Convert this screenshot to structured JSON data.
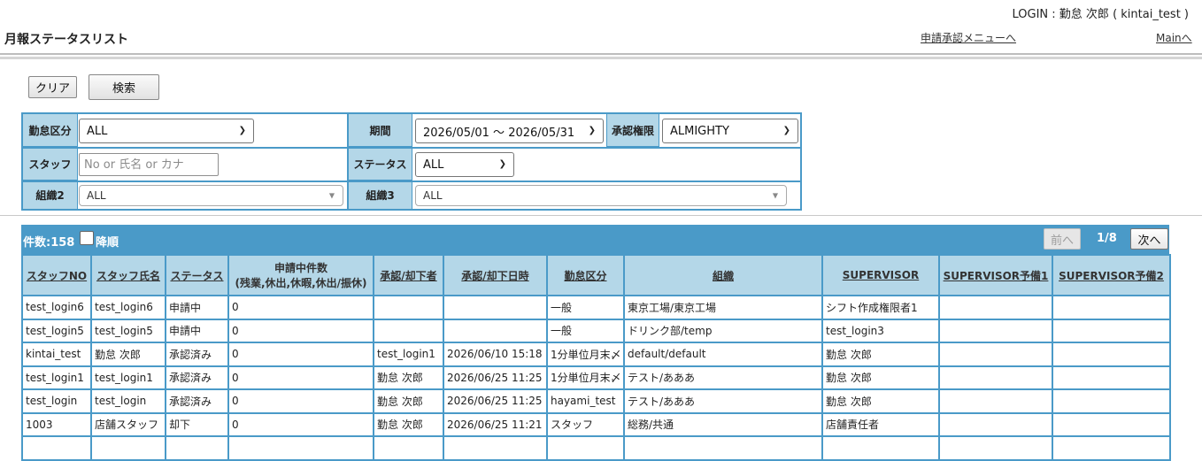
{
  "header": {
    "login": "LOGIN : 勤怠 次郎 ( kintai_test )",
    "title": "月報ステータスリスト",
    "approval_menu_link": "申請承認メニューへ",
    "main_link": "Mainへ"
  },
  "buttons": {
    "clear": "クリア",
    "search": "検索"
  },
  "filters": {
    "kintai_kubun": {
      "label": "勤怠区分",
      "value": "ALL"
    },
    "period": {
      "label": "期間",
      "value": "2026/05/01 ～ 2026/05/31"
    },
    "approval_authority": {
      "label": "承認権限",
      "value": "ALMIGHTY"
    },
    "staff": {
      "label": "スタッフ",
      "placeholder": "No or 氏名 or カナ"
    },
    "status": {
      "label": "ステータス",
      "value": "ALL"
    },
    "org2": {
      "label": "組織2",
      "value": "ALL"
    },
    "org3": {
      "label": "組織3",
      "value": "ALL"
    }
  },
  "list_bar": {
    "count": "件数:158",
    "desc_label": "降順",
    "prev": "前へ",
    "page": "1/8",
    "next": "次へ"
  },
  "table": {
    "headers": [
      "スタッフNO",
      "スタッフ氏名",
      "ステータス",
      "申請中件数\n(残業,休出,休暇,休出/振休)",
      "承認/却下者",
      "承認/却下日時",
      "勤怠区分",
      "組織",
      "SUPERVISOR",
      "SUPERVISOR予備1",
      "SUPERVISOR予備2"
    ],
    "rows": [
      [
        "test_login6",
        "test_login6",
        "申請中",
        "0",
        "",
        "",
        "一般",
        "東京工場/東京工場",
        "シフト作成権限者1",
        "",
        ""
      ],
      [
        "test_login5",
        "test_login5",
        "申請中",
        "0",
        "",
        "",
        "一般",
        "ドリンク部/temp",
        "test_login3",
        "",
        ""
      ],
      [
        "kintai_test",
        "勤怠 次郎",
        "承認済み",
        "0",
        "test_login1",
        "2026/06/10 15:18",
        "1分単位月末〆",
        "default/default",
        "勤怠 次郎",
        "",
        ""
      ],
      [
        "test_login1",
        "test_login1",
        "承認済み",
        "0",
        "勤怠 次郎",
        "2026/06/25 11:25",
        "1分単位月末〆",
        "テスト/あああ",
        "勤怠 次郎",
        "",
        ""
      ],
      [
        "test_login",
        "test_login",
        "承認済み",
        "0",
        "勤怠 次郎",
        "2026/06/25 11:25",
        "hayami_test",
        "テスト/あああ",
        "勤怠 次郎",
        "",
        ""
      ],
      [
        "1003",
        "店舗スタッフ",
        "却下",
        "0",
        "勤怠 次郎",
        "2026/06/25 11:21",
        "スタッフ",
        "総務/共通",
        "店舗責任者",
        "",
        ""
      ],
      [
        "",
        "",
        "",
        "",
        "",
        "",
        "",
        "",
        "",
        "",
        ""
      ]
    ]
  }
}
